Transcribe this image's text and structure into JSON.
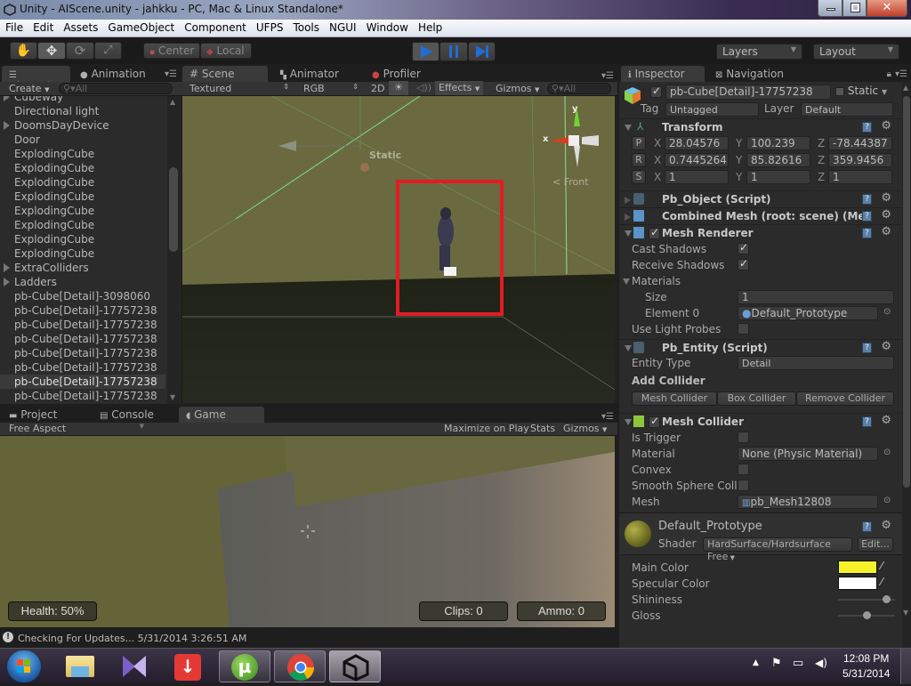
{
  "window": {
    "title": "Unity - AIScene.unity - jahkku - PC, Mac & Linux Standalone*",
    "controls": {
      "minimize": "—",
      "maximize": "❐",
      "close": "✕"
    }
  },
  "menu": [
    "File",
    "Edit",
    "Assets",
    "GameObject",
    "Component",
    "UFPS",
    "Tools",
    "NGUI",
    "Window",
    "Help"
  ],
  "toolbar": {
    "pivot": "Center",
    "space": "Local",
    "layers": "Layers",
    "layout": "Layout",
    "play_state": "playing"
  },
  "hierarchy": {
    "tab": "Hierarchy",
    "tab2": "Animation",
    "create": "Create",
    "search_placeholder": "All",
    "items": [
      {
        "label": "Cubeway",
        "expandable": true
      },
      {
        "label": "Directional light",
        "expandable": false
      },
      {
        "label": "DoomsDayDevice",
        "expandable": true
      },
      {
        "label": "Door",
        "expandable": false
      },
      {
        "label": "ExplodingCube",
        "expandable": false
      },
      {
        "label": "ExplodingCube",
        "expandable": false
      },
      {
        "label": "ExplodingCube",
        "expandable": false
      },
      {
        "label": "ExplodingCube",
        "expandable": false
      },
      {
        "label": "ExplodingCube",
        "expandable": false
      },
      {
        "label": "ExplodingCube",
        "expandable": false
      },
      {
        "label": "ExplodingCube",
        "expandable": false
      },
      {
        "label": "ExplodingCube",
        "expandable": false
      },
      {
        "label": "ExtraColliders",
        "expandable": true
      },
      {
        "label": "Ladders",
        "expandable": true
      },
      {
        "label": "pb-Cube[Detail]-3098060",
        "expandable": false
      },
      {
        "label": "pb-Cube[Detail]-17757238",
        "expandable": false
      },
      {
        "label": "pb-Cube[Detail]-17757238",
        "expandable": false
      },
      {
        "label": "pb-Cube[Detail]-17757238",
        "expandable": false
      },
      {
        "label": "pb-Cube[Detail]-17757238",
        "expandable": false
      },
      {
        "label": "pb-Cube[Detail]-17757238",
        "expandable": false
      },
      {
        "label": "pb-Cube[Detail]-17757238",
        "expandable": false,
        "selected": true
      },
      {
        "label": "pb-Cube[Detail]-17757238",
        "expandable": false
      }
    ]
  },
  "scene": {
    "tabs": [
      "Scene",
      "Animator",
      "Profiler"
    ],
    "render_mode": "Textured",
    "channel": "RGB",
    "mode2d": "2D",
    "effects": "Effects",
    "gizmos": "Gizmos",
    "search_placeholder": "All",
    "static_label": "Static",
    "gizmo_y": "y",
    "gizmo_x": "x",
    "view_label": "Front"
  },
  "bottom": {
    "tabs": [
      "Project",
      "Console",
      "Game"
    ],
    "aspect": "Free Aspect",
    "maximize": "Maximize on Play",
    "stats": "Stats",
    "gizmos": "Gizmos",
    "hud": {
      "health": "Health: 50%",
      "clips": "Clips: 0",
      "ammo": "Ammo: 0"
    }
  },
  "status": {
    "message": "Checking For Updates... 5/31/2014 3:26:51 AM"
  },
  "inspector": {
    "tab": "Inspector",
    "tab2": "Navigation",
    "object_name": "pb-Cube[Detail]-17757238",
    "active": true,
    "static_label": "Static",
    "tag_label": "Tag",
    "tag": "Untagged",
    "layer_label": "Layer",
    "layer": "Default",
    "transform": {
      "title": "Transform",
      "rows": [
        {
          "btn": "P",
          "x": "28.04576",
          "y": "100.239",
          "z": "-78.44387"
        },
        {
          "btn": "R",
          "x": "0.7445264",
          "y": "85.82616",
          "z": "359.9456"
        },
        {
          "btn": "S",
          "x": "1",
          "y": "1",
          "z": "1"
        }
      ],
      "axis": [
        "X",
        "Y",
        "Z"
      ]
    },
    "pb_object": {
      "title": "Pb_Object (Script)"
    },
    "combined_mesh": {
      "title": "Combined Mesh (root: scene) (Mesh"
    },
    "mesh_renderer": {
      "title": "Mesh Renderer",
      "enabled": true,
      "cast_shadows_label": "Cast Shadows",
      "cast_shadows": true,
      "receive_shadows_label": "Receive Shadows",
      "receive_shadows": true,
      "materials_label": "Materials",
      "size_label": "Size",
      "size": "1",
      "element0_label": "Element 0",
      "element0": "Default_Prototype",
      "light_probes_label": "Use Light Probes",
      "light_probes": false
    },
    "pb_entity": {
      "title": "Pb_Entity (Script)",
      "entity_type_label": "Entity Type",
      "entity_type": "Detail",
      "add_collider": "Add Collider",
      "buttons": [
        "Mesh Collider",
        "Box Collider",
        "Remove Collider"
      ]
    },
    "mesh_collider": {
      "title": "Mesh Collider",
      "enabled": true,
      "is_trigger_label": "Is Trigger",
      "material_label": "Material",
      "material": "None (Physic Material)",
      "convex_label": "Convex",
      "smooth_label": "Smooth Sphere Colli",
      "mesh_label": "Mesh",
      "mesh": "pb_Mesh12808"
    },
    "material": {
      "name": "Default_Prototype",
      "shader_label": "Shader",
      "shader": "HardSurface/Hardsurface Free",
      "edit": "Edit...",
      "main_color_label": "Main Color",
      "main_color": "#f5f22a",
      "specular_color_label": "Specular Color",
      "specular_color": "#ffffff",
      "shininess_label": "Shininess",
      "shininess": 0.85,
      "gloss_label": "Gloss",
      "gloss": 0.5
    }
  },
  "taskbar": {
    "apps": [
      "start",
      "explorer",
      "visual-studio",
      "download-manager",
      "utorrent",
      "chrome",
      "unity"
    ],
    "time": "12:08 PM",
    "date": "5/31/2014"
  }
}
